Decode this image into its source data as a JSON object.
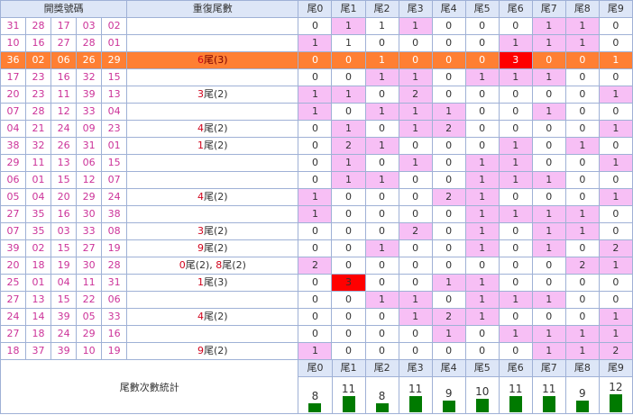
{
  "header": {
    "numbers": "開獎號碼",
    "repeat": "重復尾數",
    "tails": [
      "尾0",
      "尾1",
      "尾2",
      "尾3",
      "尾4",
      "尾5",
      "尾6",
      "尾7",
      "尾8",
      "尾9"
    ]
  },
  "rows": [
    {
      "n": [
        "31",
        "28",
        "17",
        "03",
        "02"
      ],
      "rep": "",
      "t": [
        "0",
        "1",
        "1",
        "1",
        "0",
        "0",
        "0",
        "1",
        "1",
        "0"
      ],
      "p": [
        0,
        1,
        0,
        1,
        0,
        0,
        0,
        1,
        1,
        0
      ]
    },
    {
      "n": [
        "10",
        "16",
        "27",
        "28",
        "01"
      ],
      "rep": "",
      "t": [
        "1",
        "1",
        "0",
        "0",
        "0",
        "0",
        "1",
        "1",
        "1",
        "0"
      ],
      "p": [
        1,
        0,
        0,
        0,
        0,
        0,
        1,
        1,
        1,
        0
      ]
    },
    {
      "n": [
        "36",
        "02",
        "06",
        "26",
        "29"
      ],
      "rep": "6尾(3)",
      "hl": true,
      "t": [
        "0",
        "0",
        "1",
        "0",
        "0",
        "0",
        "3",
        "0",
        "0",
        "1"
      ],
      "p": [
        0,
        0,
        1,
        0,
        0,
        0,
        2,
        0,
        0,
        1
      ]
    },
    {
      "n": [
        "17",
        "23",
        "16",
        "32",
        "15"
      ],
      "rep": "",
      "t": [
        "0",
        "0",
        "1",
        "1",
        "0",
        "1",
        "1",
        "1",
        "0",
        "0"
      ],
      "p": [
        0,
        0,
        1,
        1,
        0,
        1,
        1,
        1,
        0,
        0
      ]
    },
    {
      "n": [
        "20",
        "23",
        "11",
        "39",
        "13"
      ],
      "rep": "3尾(2)",
      "t": [
        "1",
        "1",
        "0",
        "2",
        "0",
        "0",
        "0",
        "0",
        "0",
        "1"
      ],
      "p": [
        1,
        1,
        0,
        1,
        0,
        0,
        0,
        0,
        0,
        1
      ]
    },
    {
      "n": [
        "07",
        "28",
        "12",
        "33",
        "04"
      ],
      "rep": "",
      "t": [
        "1",
        "0",
        "1",
        "1",
        "1",
        "0",
        "0",
        "1",
        "0",
        "0"
      ],
      "p": [
        1,
        0,
        1,
        1,
        1,
        0,
        0,
        1,
        0,
        0
      ]
    },
    {
      "n": [
        "04",
        "21",
        "24",
        "09",
        "23"
      ],
      "rep": "4尾(2)",
      "t": [
        "0",
        "1",
        "0",
        "1",
        "2",
        "0",
        "0",
        "0",
        "0",
        "1"
      ],
      "p": [
        0,
        1,
        0,
        1,
        1,
        0,
        0,
        0,
        0,
        1
      ]
    },
    {
      "n": [
        "38",
        "32",
        "26",
        "31",
        "01"
      ],
      "rep": "1尾(2)",
      "t": [
        "0",
        "2",
        "1",
        "0",
        "0",
        "0",
        "1",
        "0",
        "1",
        "0"
      ],
      "p": [
        0,
        1,
        1,
        0,
        0,
        0,
        1,
        0,
        1,
        0
      ]
    },
    {
      "n": [
        "29",
        "11",
        "13",
        "06",
        "15"
      ],
      "rep": "",
      "t": [
        "0",
        "1",
        "0",
        "1",
        "0",
        "1",
        "1",
        "0",
        "0",
        "1"
      ],
      "p": [
        0,
        1,
        0,
        1,
        0,
        1,
        1,
        0,
        0,
        1
      ]
    },
    {
      "n": [
        "06",
        "01",
        "15",
        "12",
        "07"
      ],
      "rep": "",
      "t": [
        "0",
        "1",
        "1",
        "0",
        "0",
        "1",
        "1",
        "1",
        "0",
        "0"
      ],
      "p": [
        0,
        1,
        1,
        0,
        0,
        1,
        1,
        1,
        0,
        0
      ]
    },
    {
      "n": [
        "05",
        "04",
        "20",
        "29",
        "24"
      ],
      "rep": "4尾(2)",
      "t": [
        "1",
        "0",
        "0",
        "0",
        "2",
        "1",
        "0",
        "0",
        "0",
        "1"
      ],
      "p": [
        1,
        0,
        0,
        0,
        1,
        1,
        0,
        0,
        0,
        1
      ]
    },
    {
      "n": [
        "27",
        "35",
        "16",
        "30",
        "38"
      ],
      "rep": "",
      "t": [
        "1",
        "0",
        "0",
        "0",
        "0",
        "1",
        "1",
        "1",
        "1",
        "0"
      ],
      "p": [
        1,
        0,
        0,
        0,
        0,
        1,
        1,
        1,
        1,
        0
      ]
    },
    {
      "n": [
        "07",
        "35",
        "03",
        "33",
        "08"
      ],
      "rep": "3尾(2)",
      "t": [
        "0",
        "0",
        "0",
        "2",
        "0",
        "1",
        "0",
        "1",
        "1",
        "0"
      ],
      "p": [
        0,
        0,
        0,
        1,
        0,
        1,
        0,
        1,
        1,
        0
      ]
    },
    {
      "n": [
        "39",
        "02",
        "15",
        "27",
        "19"
      ],
      "rep": "9尾(2)",
      "t": [
        "0",
        "0",
        "1",
        "0",
        "0",
        "1",
        "0",
        "1",
        "0",
        "2"
      ],
      "p": [
        0,
        0,
        1,
        0,
        0,
        1,
        0,
        1,
        0,
        1
      ]
    },
    {
      "n": [
        "20",
        "18",
        "19",
        "30",
        "28"
      ],
      "rep": "0尾(2), 8尾(2)",
      "t": [
        "2",
        "0",
        "0",
        "0",
        "0",
        "0",
        "0",
        "0",
        "2",
        "1"
      ],
      "p": [
        1,
        0,
        0,
        0,
        0,
        0,
        0,
        0,
        1,
        1
      ]
    },
    {
      "n": [
        "25",
        "01",
        "04",
        "11",
        "31"
      ],
      "rep": "1尾(3)",
      "t": [
        "0",
        "3",
        "0",
        "0",
        "1",
        "1",
        "0",
        "0",
        "0",
        "0"
      ],
      "p": [
        0,
        2,
        0,
        0,
        1,
        1,
        0,
        0,
        0,
        0
      ]
    },
    {
      "n": [
        "27",
        "13",
        "15",
        "22",
        "06"
      ],
      "rep": "",
      "t": [
        "0",
        "0",
        "1",
        "1",
        "0",
        "1",
        "1",
        "1",
        "0",
        "0"
      ],
      "p": [
        0,
        0,
        1,
        1,
        0,
        1,
        1,
        1,
        0,
        0
      ]
    },
    {
      "n": [
        "24",
        "14",
        "39",
        "05",
        "33"
      ],
      "rep": "4尾(2)",
      "t": [
        "0",
        "0",
        "0",
        "1",
        "2",
        "1",
        "0",
        "0",
        "0",
        "1"
      ],
      "p": [
        0,
        0,
        0,
        1,
        1,
        1,
        0,
        0,
        0,
        1
      ]
    },
    {
      "n": [
        "27",
        "18",
        "24",
        "29",
        "16"
      ],
      "rep": "",
      "t": [
        "0",
        "0",
        "0",
        "0",
        "1",
        "0",
        "1",
        "1",
        "1",
        "1"
      ],
      "p": [
        0,
        0,
        0,
        0,
        1,
        0,
        1,
        1,
        1,
        1
      ]
    },
    {
      "n": [
        "18",
        "37",
        "39",
        "10",
        "19"
      ],
      "rep": "9尾(2)",
      "t": [
        "1",
        "0",
        "0",
        "0",
        "0",
        "0",
        "0",
        "1",
        "1",
        "2"
      ],
      "p": [
        1,
        0,
        0,
        0,
        0,
        0,
        0,
        1,
        1,
        1
      ]
    }
  ],
  "footer": {
    "title": "尾數次數統計",
    "tails": [
      "尾0",
      "尾1",
      "尾2",
      "尾3",
      "尾4",
      "尾5",
      "尾6",
      "尾7",
      "尾8",
      "尾9"
    ],
    "counts": [
      8,
      11,
      8,
      11,
      9,
      10,
      11,
      11,
      9,
      12
    ],
    "bar_color": "#007a00"
  }
}
